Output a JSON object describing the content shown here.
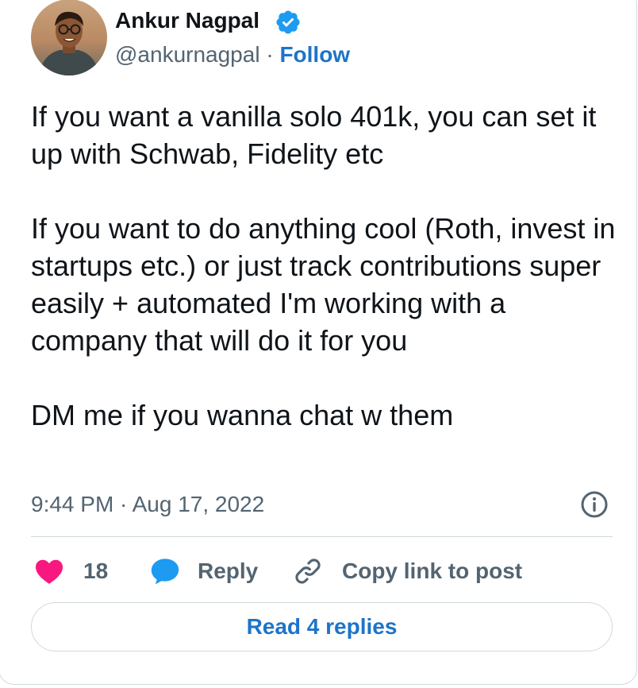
{
  "author": {
    "name": "Ankur Nagpal",
    "handle": "@ankurnagpal",
    "separator": " · ",
    "follow_label": "Follow",
    "verified_color": "#1d9bf0"
  },
  "tweet": {
    "paragraphs": [
      "If you want a vanilla solo 401k, you can set it up with Schwab, Fidelity etc",
      "If you want to do anything cool (Roth, invest in startups etc.) or just track contributions super easily + automated I'm working with a company that will do it for you",
      "DM me if you wanna chat w them"
    ],
    "timestamp": "9:44 PM · Aug 17, 2022"
  },
  "actions": {
    "like_count": "18",
    "reply_label": "Reply",
    "copy_link_label": "Copy link to post",
    "like_color": "#f91880",
    "reply_color": "#1d9bf0"
  },
  "read_replies_label": "Read 4 replies"
}
